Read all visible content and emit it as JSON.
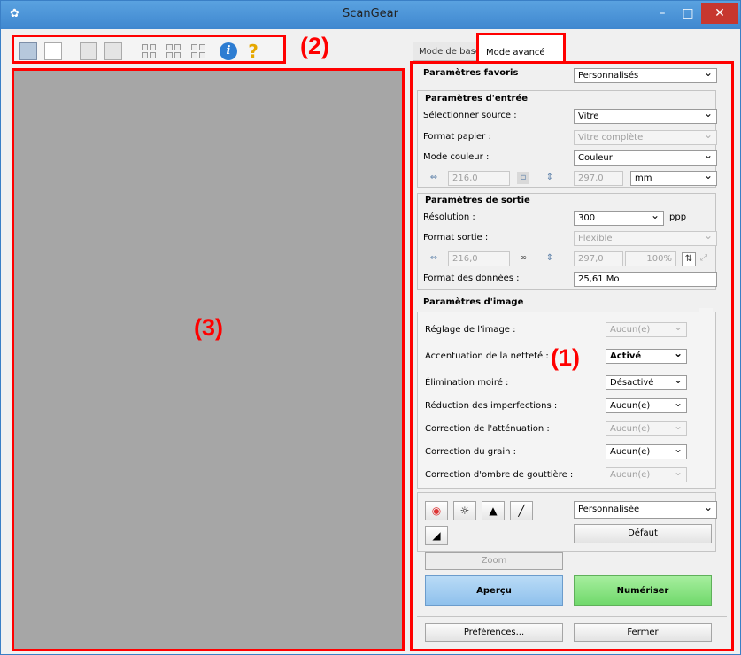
{
  "window": {
    "title": "ScanGear",
    "minimize": "–",
    "maximize": "□",
    "close": "✕"
  },
  "annotations": {
    "one": "(1)",
    "two": "(2)",
    "three": "(3)"
  },
  "tabs": {
    "basic": "Mode de base",
    "advanced": "Mode avancé"
  },
  "fav": {
    "label": "Paramètres favoris",
    "value": "Personnalisés"
  },
  "input": {
    "title": "Paramètres d'entrée",
    "source_label": "Sélectionner source :",
    "source_value": "Vitre",
    "paper_label": "Format papier :",
    "paper_value": "Vitre complète",
    "color_label": "Mode couleur :",
    "color_value": "Couleur",
    "width": "216,0",
    "height": "297,0",
    "unit": "mm"
  },
  "output": {
    "title": "Paramètres de sortie",
    "res_label": "Résolution :",
    "res_value": "300",
    "res_unit": "ppp",
    "format_label": "Format sortie :",
    "format_value": "Flexible",
    "width": "216,0",
    "height": "297,0",
    "scale": "100%",
    "data_label": "Format des données :",
    "data_value": "25,61 Mo"
  },
  "image": {
    "title": "Paramètres d'image",
    "rows": [
      {
        "label": "Réglage de l'image :",
        "value": "Aucun(e)"
      },
      {
        "label": "Accentuation de la netteté :",
        "value": "Activé"
      },
      {
        "label": "Élimination moiré :",
        "value": "Désactivé"
      },
      {
        "label": "Réduction des imperfections :",
        "value": "Aucun(e)"
      },
      {
        "label": "Correction de l'atténuation :",
        "value": "Aucun(e)"
      },
      {
        "label": "Correction du grain :",
        "value": "Aucun(e)"
      },
      {
        "label": "Correction d'ombre de gouttière :",
        "value": "Aucun(e)"
      }
    ]
  },
  "color_settings": {
    "preset": "Personnalisée",
    "default": "Défaut"
  },
  "actions": {
    "zoom": "Zoom",
    "preview": "Aperçu",
    "scan": "Numériser",
    "preferences": "Préférences...",
    "close": "Fermer"
  },
  "icons": {
    "toolbar": [
      "rotate-left-icon",
      "blank-icon",
      "rotate-right-icon",
      "rotate-icon",
      "grid-icon",
      "grid-icon",
      "grid-icon",
      "info-icon",
      "help-icon"
    ],
    "adjust": [
      "color-wheel-icon",
      "brightness-icon",
      "histogram-icon",
      "tone-curve-icon",
      "threshold-icon"
    ]
  },
  "colors": {
    "preview_bg": "#a6a6a6",
    "highlight": "#ff0000",
    "preview_button": "#8ec0ec",
    "scan_button": "#6fd86a"
  }
}
